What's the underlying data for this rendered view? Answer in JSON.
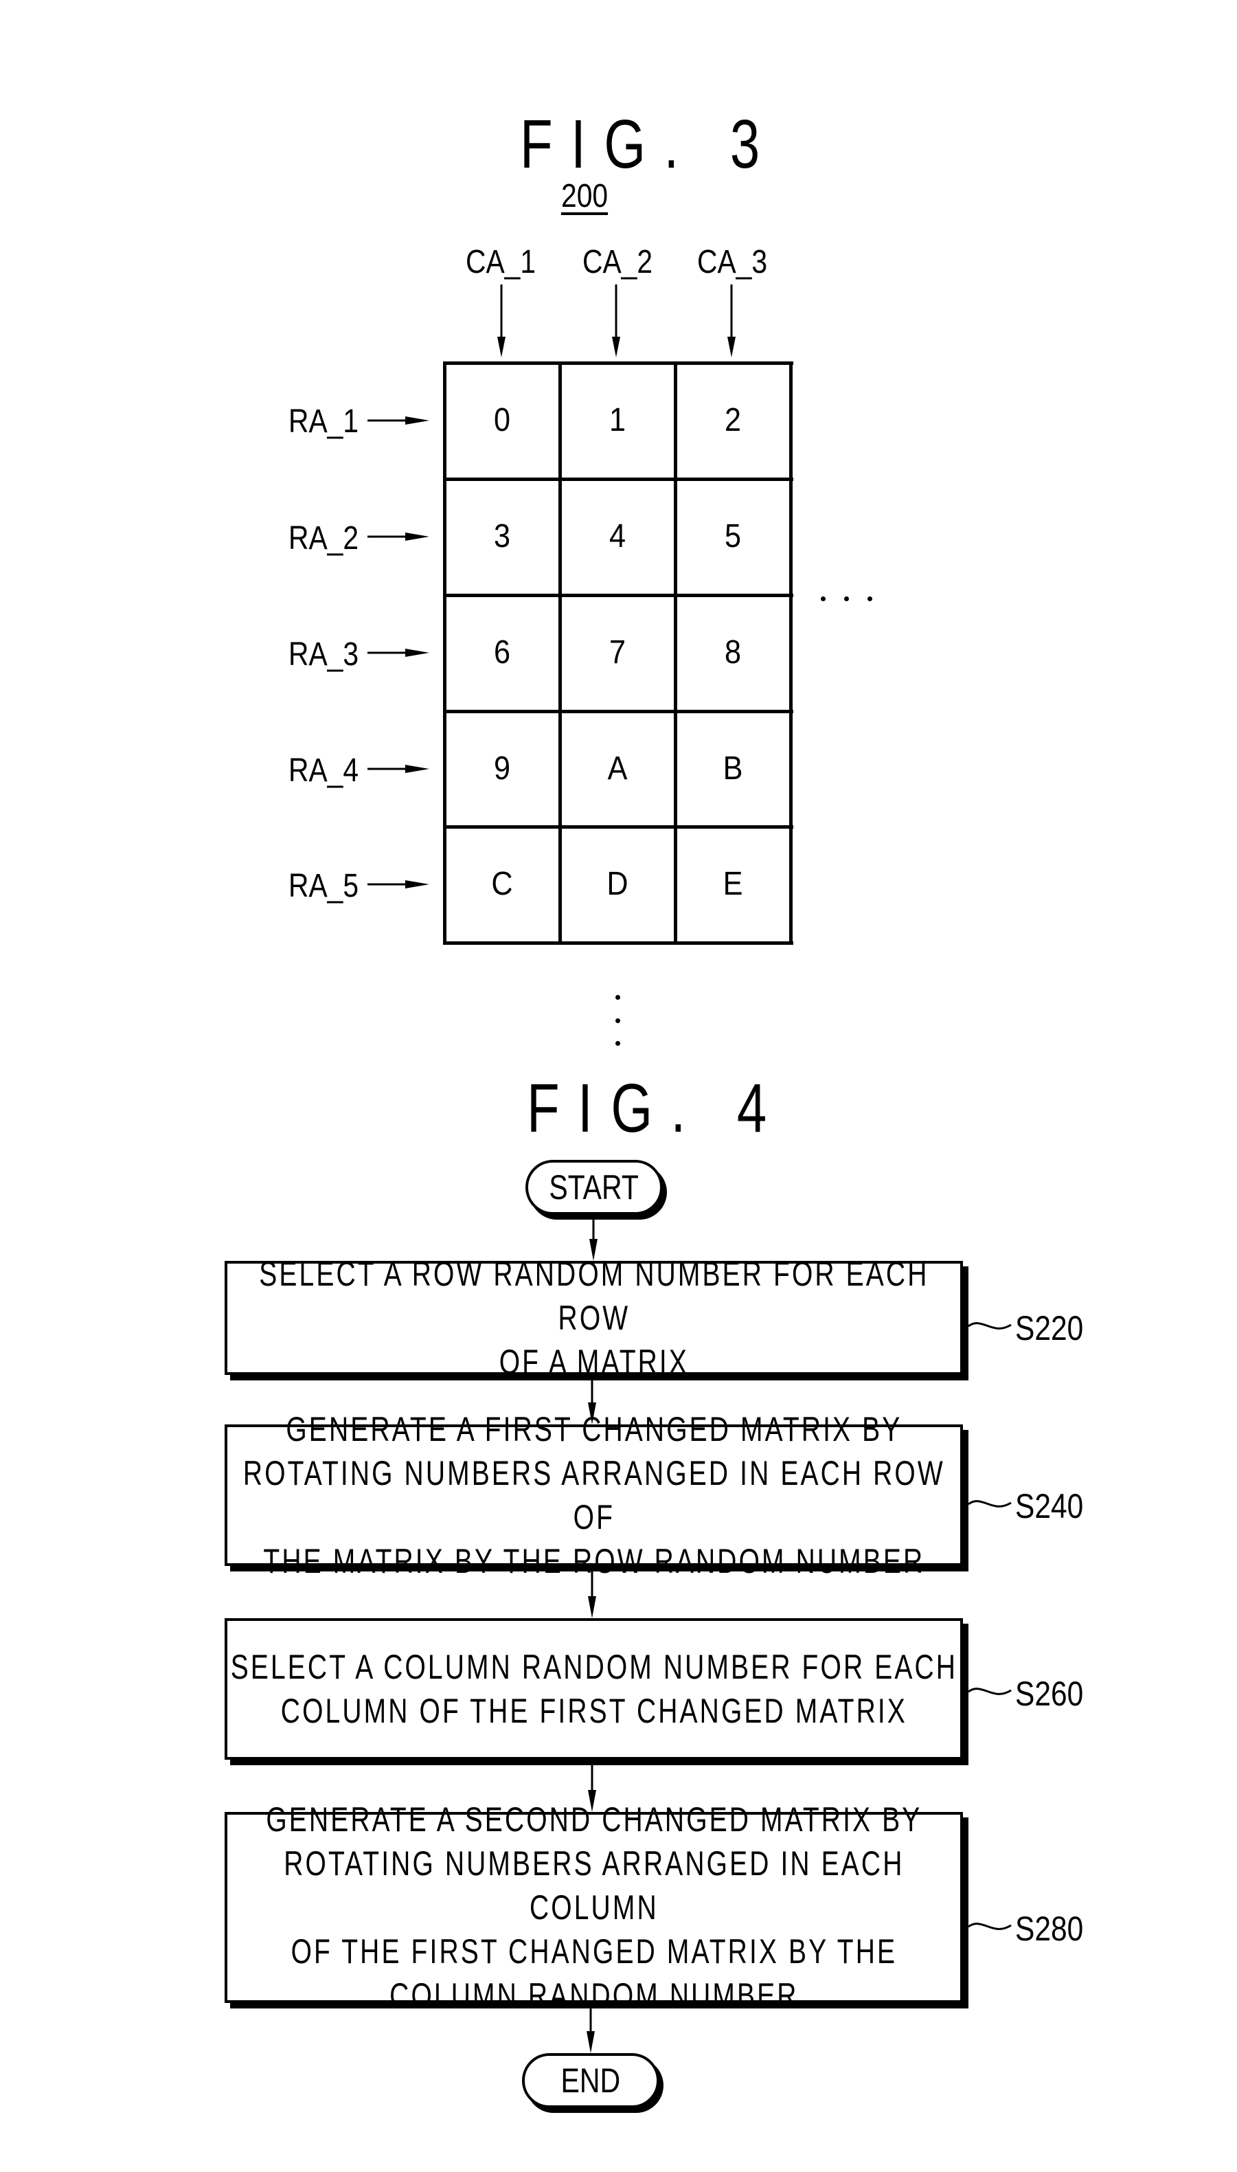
{
  "fig3": {
    "title": "FIG. 3",
    "reference": "200",
    "column_labels": [
      "CA_1",
      "CA_2",
      "CA_3"
    ],
    "row_labels": [
      "RA_1",
      "RA_2",
      "RA_3",
      "RA_4",
      "RA_5"
    ],
    "cells": [
      [
        "0",
        "1",
        "2"
      ],
      [
        "3",
        "4",
        "5"
      ],
      [
        "6",
        "7",
        "8"
      ],
      [
        "9",
        "A",
        "B"
      ],
      [
        "C",
        "D",
        "E"
      ]
    ],
    "continuation_right": "...",
    "continuation_down": "..."
  },
  "fig4": {
    "title": "FIG. 4",
    "start_label": "START",
    "end_label": "END",
    "steps": [
      {
        "id": "S220",
        "text": "SELECT A ROW RANDOM NUMBER FOR EACH ROW\nOF A MATRIX"
      },
      {
        "id": "S240",
        "text": "GENERATE A FIRST CHANGED MATRIX BY\nROTATING NUMBERS ARRANGED IN EACH ROW OF\nTHE MATRIX BY THE ROW RANDOM NUMBER"
      },
      {
        "id": "S260",
        "text": "SELECT A COLUMN RANDOM NUMBER FOR EACH\nCOLUMN OF THE FIRST CHANGED MATRIX"
      },
      {
        "id": "S280",
        "text": "GENERATE A SECOND CHANGED MATRIX BY\nROTATING NUMBERS ARRANGED IN EACH COLUMN\nOF THE FIRST CHANGED MATRIX BY THE\nCOLUMN RANDOM NUMBER"
      }
    ]
  }
}
